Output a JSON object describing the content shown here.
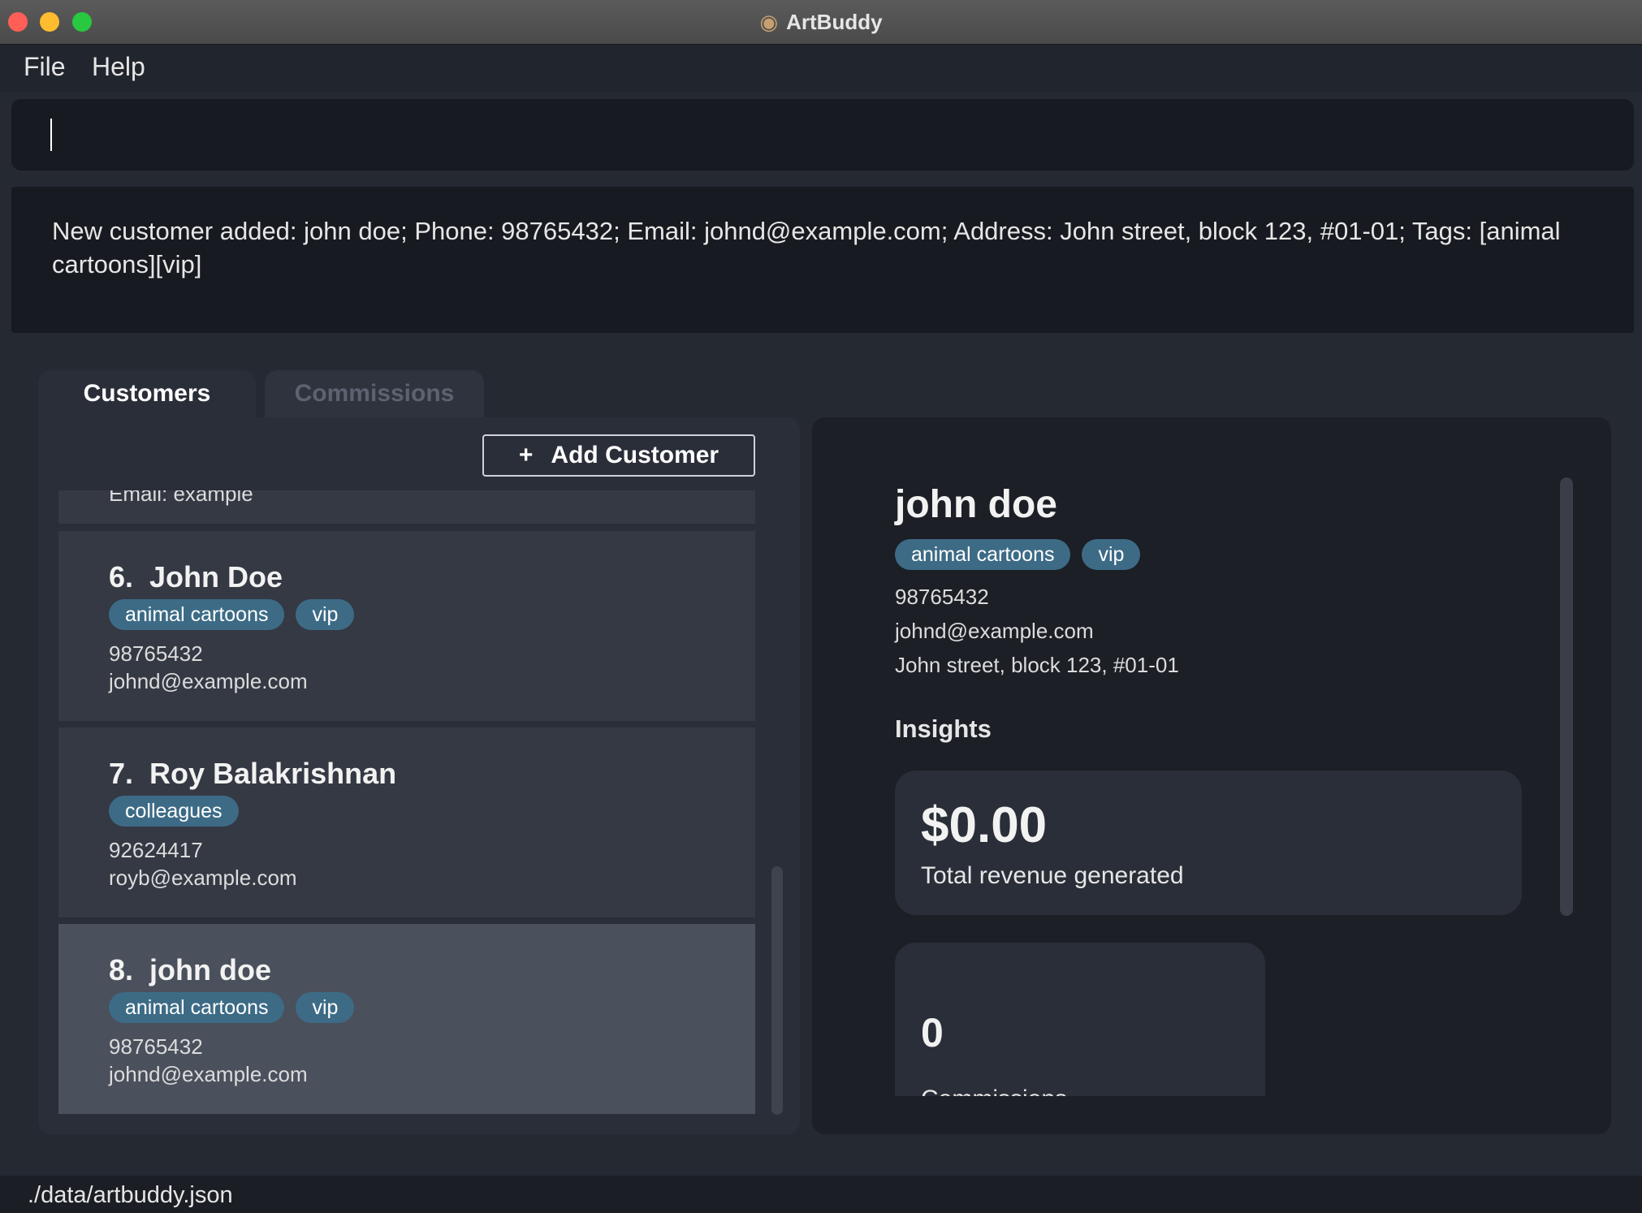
{
  "window": {
    "title": "ArtBuddy",
    "icon": "palette-icon"
  },
  "menu": {
    "items": [
      {
        "label": "File"
      },
      {
        "label": "Help"
      }
    ]
  },
  "command": {
    "value": "",
    "placeholder": ""
  },
  "result": {
    "message": "New customer added: john doe; Phone: 98765432; Email: johnd@example.com; Address: John street, block 123, #01-01; Tags: [animal cartoons][vip]"
  },
  "tabs": [
    {
      "label": "Customers",
      "active": true
    },
    {
      "label": "Commissions",
      "active": false
    }
  ],
  "toolbar": {
    "add_icon": "+",
    "add_label": "Add Customer"
  },
  "customer_list": {
    "partial_top_text": "Email: example",
    "items": [
      {
        "name": "6.  John Doe",
        "tags": [
          "animal cartoons",
          "vip"
        ],
        "phone": "98765432",
        "email": "johnd@example.com"
      },
      {
        "name": "7.  Roy Balakrishnan",
        "tags": [
          "colleagues"
        ],
        "phone": "92624417",
        "email": "royb@example.com"
      },
      {
        "name": "8.  john doe",
        "tags": [
          "animal cartoons",
          "vip"
        ],
        "phone": "98765432",
        "email": "johnd@example.com",
        "selected": true
      }
    ]
  },
  "detail": {
    "name": "john doe",
    "tags": [
      "animal cartoons",
      "vip"
    ],
    "phone": "98765432",
    "email": "johnd@example.com",
    "address": "John street, block 123, #01-01",
    "insights_title": "Insights",
    "revenue_value": "$0.00",
    "revenue_label": "Total revenue generated",
    "commissions_value": "0",
    "commissions_label": "Commissions"
  },
  "status": {
    "path": "./data/artbuddy.json"
  },
  "colors": {
    "background": "#252932",
    "panel": "#2a2e38",
    "card": "#343944",
    "card_selected": "#4a505c",
    "tag": "#3d6b86",
    "detail_panel": "#1c1f26"
  }
}
